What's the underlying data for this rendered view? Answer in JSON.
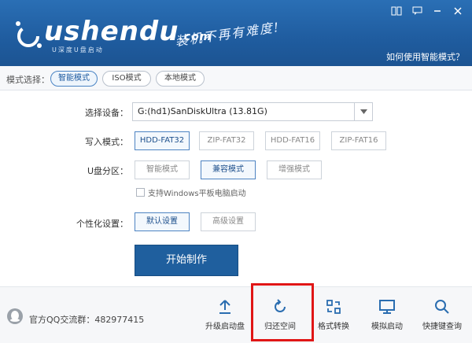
{
  "header": {
    "logo_text": "ushendu",
    "logo_suffix": ".com",
    "logo_sub": "U深度U盘启动",
    "slogan": "装机不再有难度!",
    "help_link": "如何使用智能模式？"
  },
  "mode_bar": {
    "label": "模式选择：",
    "modes": [
      "智能模式",
      "ISO模式",
      "本地模式"
    ],
    "active": "智能模式"
  },
  "form": {
    "device_label": "选择设备：",
    "device_value": "G:(hd1)SanDiskUltra (13.81G)",
    "write_label": "写入模式：",
    "write_options": [
      "HDD-FAT32",
      "ZIP-FAT32",
      "HDD-FAT16",
      "ZIP-FAT16"
    ],
    "partition_label": "U盘分区：",
    "partition_options": [
      "智能模式",
      "兼容模式",
      "增强模式"
    ],
    "windows_tablet_label": "支持Windows平板电脑启动",
    "personal_label": "个性化设置：",
    "personal_options": [
      "默认设置",
      "高级设置"
    ],
    "start_button": "开始制作"
  },
  "footer": {
    "qq_label": "官方QQ交流群：482977415",
    "tools": [
      "升级启动盘",
      "归还空间",
      "格式转换",
      "模拟启动",
      "快捷键查询"
    ]
  },
  "colors": {
    "header_blue": "#1f5c9f",
    "accent": "#1f5f9e",
    "highlight_red": "#e01616"
  }
}
